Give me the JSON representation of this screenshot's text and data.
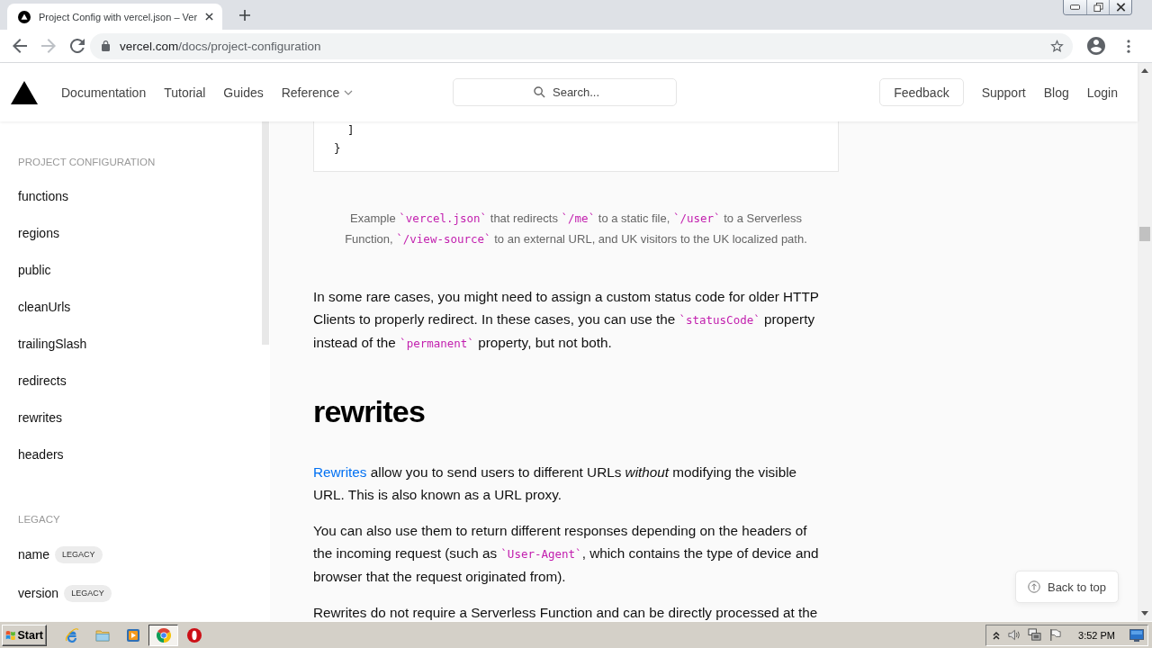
{
  "browser": {
    "tab": {
      "title": "Project Config with vercel.json – Ver"
    },
    "nav_buttons": [
      {
        "kind": "back",
        "disabled": false
      },
      {
        "kind": "forward",
        "disabled": true
      },
      {
        "kind": "reload",
        "disabled": false
      }
    ],
    "url": {
      "domain": "vercel.com",
      "path": "/docs/project-configuration"
    }
  },
  "site_header": {
    "nav": [
      {
        "label": "Documentation",
        "dropdown": false
      },
      {
        "label": "Tutorial",
        "dropdown": false
      },
      {
        "label": "Guides",
        "dropdown": false
      },
      {
        "label": "Reference",
        "dropdown": true
      }
    ],
    "search": {
      "placeholder": "Search..."
    },
    "feedback_button": "Feedback",
    "links": [
      "Support",
      "Blog",
      "Login"
    ]
  },
  "sidebar": {
    "sections": [
      {
        "title": "PROJECT CONFIGURATION",
        "items": [
          {
            "label": "functions"
          },
          {
            "label": "regions"
          },
          {
            "label": "public"
          },
          {
            "label": "cleanUrls"
          },
          {
            "label": "trailingSlash"
          },
          {
            "label": "redirects"
          },
          {
            "label": "rewrites"
          },
          {
            "label": "headers"
          }
        ]
      },
      {
        "title": "LEGACY",
        "items": [
          {
            "label": "name",
            "badge": "LEGACY"
          },
          {
            "label": "version",
            "badge": "LEGACY"
          }
        ]
      }
    ]
  },
  "content": {
    "blocks": [
      {
        "kind": "code",
        "lines": [
          "  ]",
          "}"
        ]
      },
      {
        "kind": "caption",
        "segments": [
          {
            "kind": "text",
            "text": "Example "
          },
          {
            "kind": "code",
            "text": "`vercel.json`"
          },
          {
            "kind": "text",
            "text": " that redirects "
          },
          {
            "kind": "code",
            "text": "`/me`"
          },
          {
            "kind": "text",
            "text": " to a static file, "
          },
          {
            "kind": "code",
            "text": "`/user`"
          },
          {
            "kind": "text",
            "text": " to a Serverless Function, "
          },
          {
            "kind": "code",
            "text": "`/view-source`"
          },
          {
            "kind": "text",
            "text": " to an external URL, and UK visitors to the UK localized path."
          }
        ]
      },
      {
        "kind": "paragraph",
        "segments": [
          {
            "kind": "text",
            "text": "In some rare cases, you might need to assign a custom status code for older HTTP Clients to properly redirect. In these cases, you can use the "
          },
          {
            "kind": "code",
            "text": "`statusCode`"
          },
          {
            "kind": "text",
            "text": " property instead of the "
          },
          {
            "kind": "code",
            "text": "`permanent`"
          },
          {
            "kind": "text",
            "text": " property, but not both."
          }
        ]
      },
      {
        "kind": "heading",
        "text": "rewrites"
      },
      {
        "kind": "paragraph",
        "segments": [
          {
            "kind": "link",
            "text": "Rewrites"
          },
          {
            "kind": "text",
            "text": " allow you to send users to different URLs *without* modifying the visible URL. This is also known as a URL proxy."
          }
        ]
      },
      {
        "kind": "paragraph",
        "segments": [
          {
            "kind": "text",
            "text": "You can also use them to return different responses depending on the headers of the incoming request (such as "
          },
          {
            "kind": "code",
            "text": "`User-Agent`"
          },
          {
            "kind": "text",
            "text": ", which contains the type of device and browser that the request originated from)."
          }
        ]
      },
      {
        "kind": "paragraph",
        "segments": [
          {
            "kind": "text",
            "text": "Rewrites do not require a Serverless Function and can be directly processed at the"
          }
        ]
      }
    ],
    "back_to_top": "Back to top"
  },
  "taskbar": {
    "start": "Start",
    "apps": [
      {
        "kind": "ie",
        "selected": false
      },
      {
        "kind": "folder",
        "selected": false
      },
      {
        "kind": "media",
        "selected": false
      },
      {
        "kind": "chrome",
        "selected": true
      },
      {
        "kind": "opera",
        "selected": false
      }
    ],
    "clock": "3:52 PM"
  }
}
